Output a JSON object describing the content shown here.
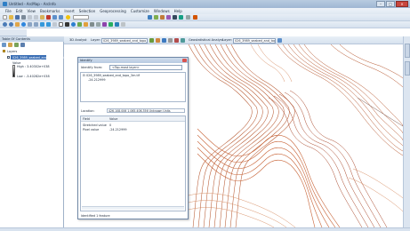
{
  "window": {
    "title": "Untitled - ArcMap - ArcInfo",
    "controls": {
      "minimize": "–",
      "maximize": "□",
      "close": "×"
    }
  },
  "menu": [
    "File",
    "Edit",
    "View",
    "Bookmarks",
    "Insert",
    "Selection",
    "Geoprocessing",
    "Customize",
    "Windows",
    "Help"
  ],
  "toc": {
    "title": "Table Of Contents",
    "root": "Layers",
    "layer_name": "026_3989_seabed_and_topo_3m.tif",
    "legend_label": "Value",
    "high": "High : 3.40302e+038",
    "low": "Low : -3.40282e+038"
  },
  "map_toolbar": {
    "three_d_analyst": "3D Analyst",
    "layer_label": "Layer:",
    "layer_value": "026_3989_seabed_and_topo_3m.tif",
    "geostat": "Geostatistical Analyst",
    "layer_label_2": "Layer:",
    "layer_value_2": "026_3989_seabed_and_topo_3m"
  },
  "identify": {
    "title": "Identify",
    "from_label": "Identify from:",
    "from_value": "<Top-most layer>",
    "tree_layer": "026_3989_seabed_and_topo_3m.tif",
    "tree_value": "-24.212999",
    "location_label": "Location:",
    "location_value": "426,108.006  1,065,406.356 Unknown Units",
    "col_field": "Field",
    "col_value": "Value",
    "rows": [
      {
        "field": "Stretched value",
        "value": "0"
      },
      {
        "field": "Pixel value",
        "value": "-24.212999"
      }
    ],
    "footer": "Identified 1 feature"
  },
  "colors": {
    "contour": "#b4532a",
    "contour_light": "#d4875a",
    "accent": "#3b6fb5"
  }
}
